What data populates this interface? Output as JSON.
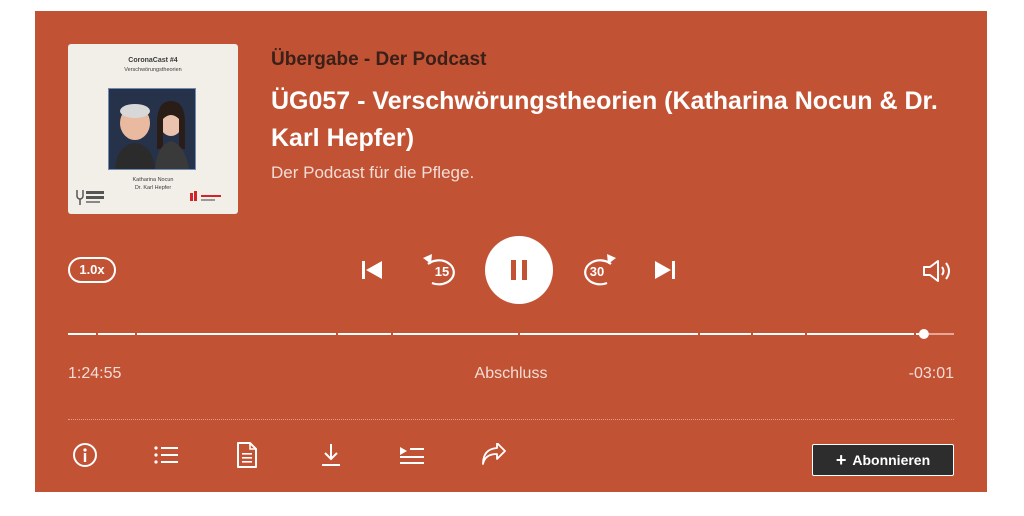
{
  "cover": {
    "title": "CoronaCast #4",
    "subtitle": "Verschwörungstheorien",
    "guests": [
      "Katharina Nocun",
      "Dr. Karl Hepfer"
    ]
  },
  "episode": {
    "show": "Übergabe - Der Podcast",
    "title": "ÜG057 - Verschwörungstheorien (Katharina Nocun & Dr. Karl Hepfer)",
    "description": "Der Podcast für die Pflege."
  },
  "controls": {
    "speed": "1.0x",
    "rewind_seconds": "15",
    "forward_seconds": "30",
    "state": "playing",
    "icons": [
      "skip-back-icon",
      "rewind-15-icon",
      "pause-icon",
      "forward-30-icon",
      "skip-forward-icon",
      "volume-icon"
    ]
  },
  "progress": {
    "elapsed": "1:24:55",
    "chapter": "Abschluss",
    "remaining": "-03:01",
    "fraction": 0.966
  },
  "actions": {
    "icons": [
      "info-icon",
      "chapters-list-icon",
      "transcript-icon",
      "download-icon",
      "playlist-icon",
      "share-icon"
    ],
    "subscribe_label": "Abonnieren"
  },
  "colors": {
    "background": "#c25234",
    "show_title": "#3a2019",
    "button_dark": "#2d2d2d"
  }
}
